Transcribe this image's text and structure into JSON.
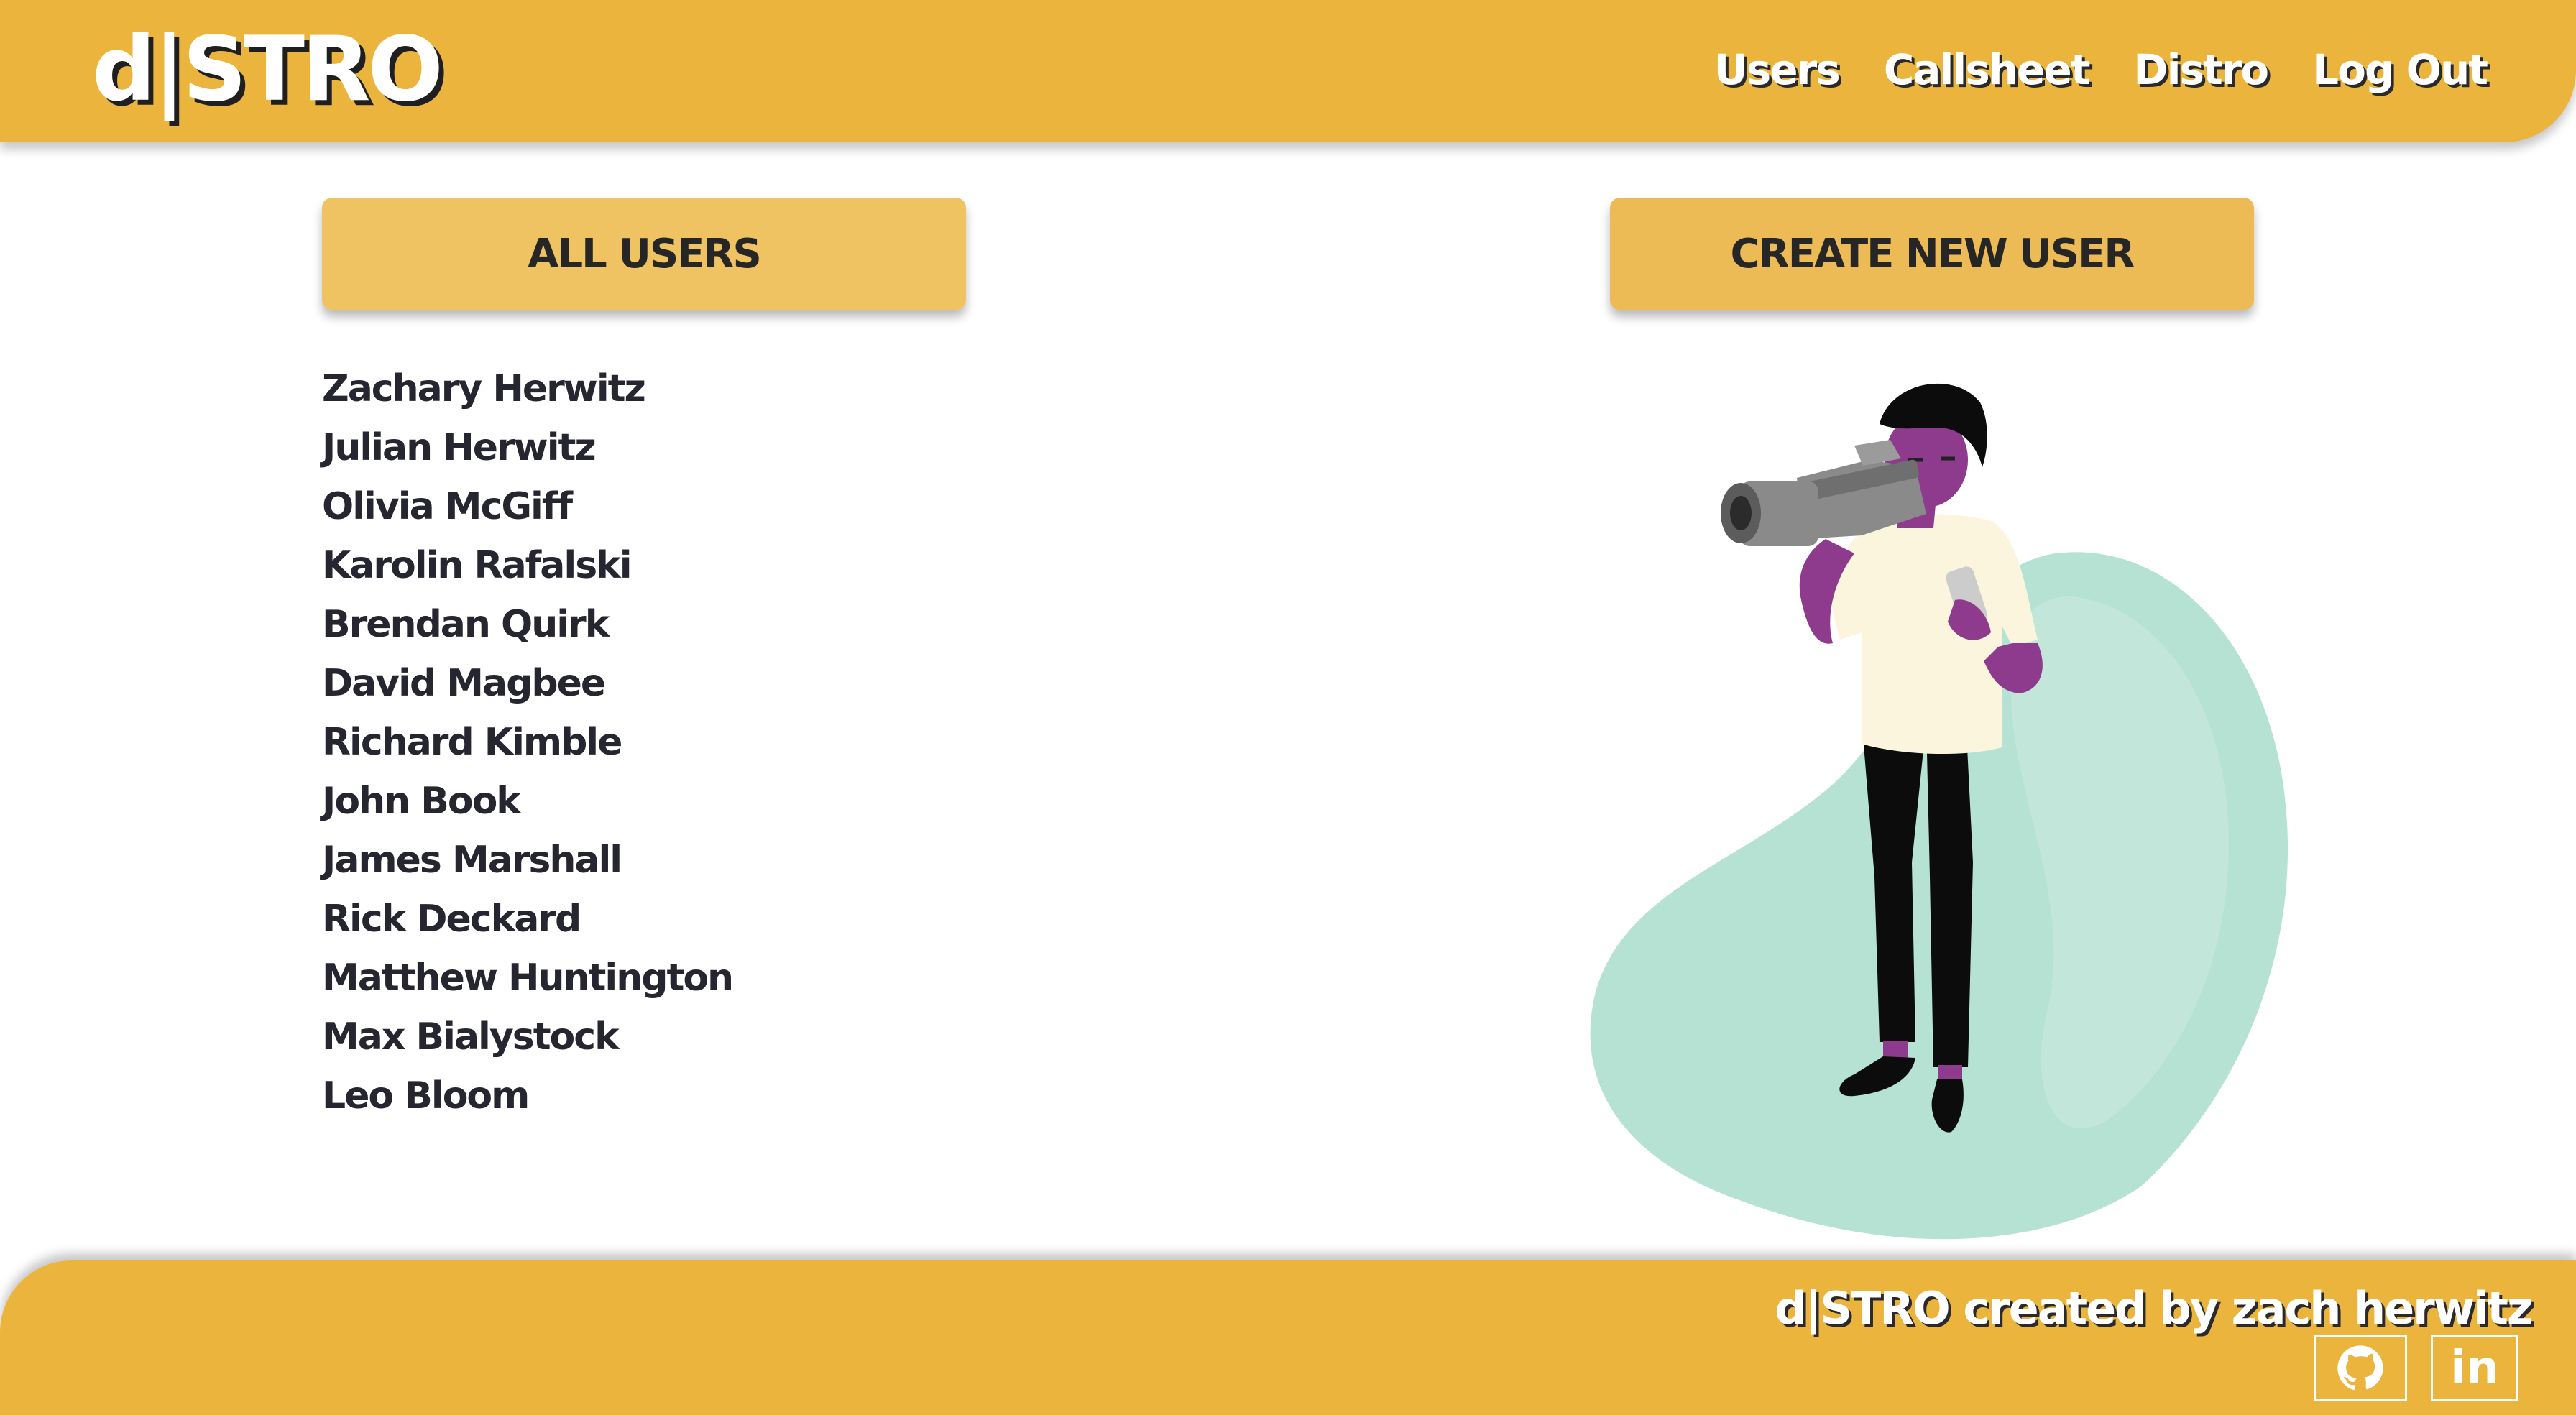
{
  "header": {
    "logo": "d|STRO",
    "nav": [
      "Users",
      "Callsheet",
      "Distro",
      "Log Out"
    ]
  },
  "buttons": {
    "all_users": "ALL USERS",
    "create_user": "CREATE NEW USER"
  },
  "users": [
    "Zachary Herwitz",
    "Julian Herwitz",
    "Olivia McGiff",
    "Karolin Rafalski",
    "Brendan Quirk",
    "David Magbee",
    "Richard Kimble",
    "John Book",
    "James Marshall",
    "Rick Deckard",
    "Matthew Huntington",
    "Max Bialystock",
    "Leo Bloom"
  ],
  "footer": {
    "credit": "d|STRO created by zach herwitz",
    "linkedin_label": "in"
  },
  "colors": {
    "brand_yellow": "#ebb43c",
    "button_yellow": "#eebf5c",
    "text_dark": "#262630",
    "blob_green": "#b6e2d3",
    "figure_purple": "#8e3b8e"
  },
  "icons": {
    "github": "github-icon",
    "linkedin": "linkedin-icon"
  }
}
